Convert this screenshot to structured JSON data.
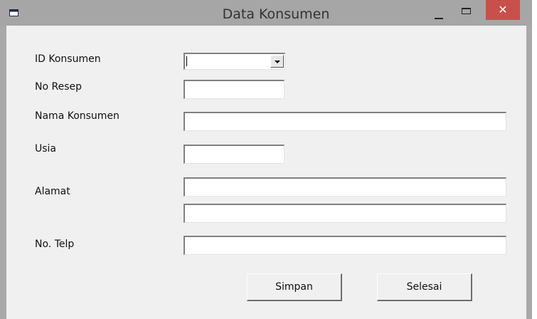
{
  "window": {
    "title": "Data Konsumen",
    "close_glyph": "✕",
    "colors": {
      "titlebar": "#a6a6a6",
      "close_button": "#c7504a",
      "client": "#f0f0f0"
    }
  },
  "form": {
    "id_konsumen": {
      "label": "ID Konsumen",
      "value": ""
    },
    "no_resep": {
      "label": "No Resep",
      "value": ""
    },
    "nama_konsumen": {
      "label": "Nama Konsumen",
      "value": ""
    },
    "usia": {
      "label": "Usia",
      "value": ""
    },
    "alamat": {
      "label": "Alamat",
      "value_line1": "",
      "value_line2": ""
    },
    "no_telp": {
      "label": "No. Telp",
      "value": ""
    }
  },
  "buttons": {
    "simpan": "Simpan",
    "selesai": "Selesai"
  },
  "icons": {
    "app": "window-icon",
    "minimize": "minimize-icon",
    "maximize": "maximize-icon",
    "close": "close-icon",
    "dropdown": "chevron-down-icon"
  }
}
